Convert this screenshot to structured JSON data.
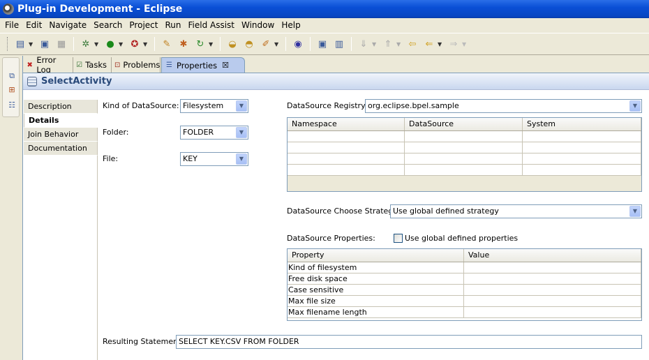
{
  "window": {
    "title": "Plug-in Development - Eclipse"
  },
  "menu": [
    "File",
    "Edit",
    "Navigate",
    "Search",
    "Project",
    "Run",
    "Field Assist",
    "Window",
    "Help"
  ],
  "tabs": [
    {
      "label": "Error Log",
      "icon": "error-log-icon"
    },
    {
      "label": "Tasks",
      "icon": "tasks-icon"
    },
    {
      "label": "Problems",
      "icon": "problems-icon"
    },
    {
      "label": "Properties",
      "icon": "properties-icon",
      "active": true
    }
  ],
  "properties": {
    "title": "SelectActivity",
    "sections": [
      "Description",
      "Details",
      "Join Behavior",
      "Documentation"
    ],
    "active_section": "Details"
  },
  "form": {
    "kind_label": "Kind of DataSource:",
    "kind_value": "Filesystem",
    "folder_label": "Folder:",
    "folder_value": "FOLDER",
    "file_label": "File:",
    "file_value": "KEY",
    "registry_label": "DataSource Registry:",
    "registry_value": "org.eclipse.bpel.sample",
    "registry_table": {
      "columns": [
        "Namespace",
        "DataSource",
        "System"
      ],
      "rows": [
        [
          "",
          "",
          ""
        ],
        [
          "",
          "",
          ""
        ],
        [
          "",
          "",
          ""
        ],
        [
          "",
          "",
          ""
        ]
      ]
    },
    "strategy_label": "DataSource Choose Strategy:",
    "strategy_value": "Use global defined strategy",
    "props_label": "DataSource Properties:",
    "use_global_label": "Use global defined properties",
    "use_global_checked": false,
    "props_table": {
      "columns": [
        "Property",
        "Value"
      ],
      "rows": [
        [
          "Kind of filesystem",
          ""
        ],
        [
          "Free disk space",
          ""
        ],
        [
          "Case sensitive",
          ""
        ],
        [
          "Max file size",
          ""
        ],
        [
          "Max filename length",
          ""
        ]
      ]
    },
    "result_label": "Resulting Statement:",
    "result_value": "SELECT KEY.CSV FROM FOLDER"
  }
}
